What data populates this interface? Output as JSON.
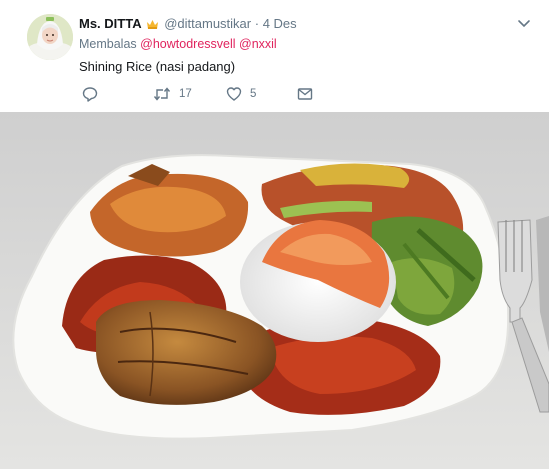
{
  "tweet": {
    "display_name": "Ms. DITTA",
    "handle": "@dittamustikar",
    "separator": "·",
    "date": "4 Des",
    "reply_prefix": "Membalas",
    "mentions": [
      "@howtodressvell",
      "@nxxil"
    ],
    "text": "Shining Rice (nasi padang)"
  },
  "actions": {
    "reply": {
      "icon": "reply-icon",
      "count": ""
    },
    "retweet": {
      "icon": "retweet-icon",
      "count": "17"
    },
    "like": {
      "icon": "heart-icon",
      "count": "5"
    },
    "message": {
      "icon": "envelope-icon",
      "count": ""
    }
  },
  "colors": {
    "mention": "#e0245e",
    "muted": "#657786",
    "text": "#14171a"
  }
}
